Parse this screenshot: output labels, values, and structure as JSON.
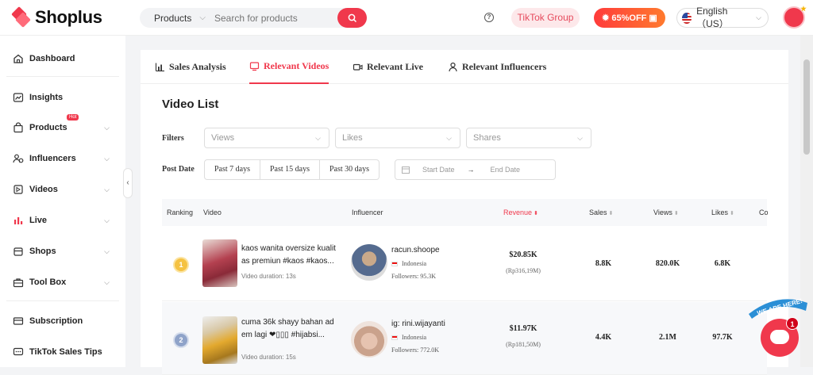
{
  "brand": {
    "name": "Shoplus",
    "accent": "#f0384c"
  },
  "topbar": {
    "search_type": "Products",
    "search_placeholder": "Search for products",
    "tiktok_group": "TikTok Group",
    "promo": "65%OFF",
    "language": "English（US）"
  },
  "sidebar": {
    "items": [
      {
        "label": "Dashboard",
        "icon": "home-icon"
      },
      {
        "label": "Insights",
        "icon": "chart-line-icon"
      },
      {
        "label": "Products",
        "icon": "bag-icon",
        "badge": "Hot"
      },
      {
        "label": "Influencers",
        "icon": "people-icon"
      },
      {
        "label": "Videos",
        "icon": "video-icon"
      },
      {
        "label": "Live",
        "icon": "bar-chart-icon"
      },
      {
        "label": "Shops",
        "icon": "shop-icon"
      },
      {
        "label": "Tool Box",
        "icon": "toolbox-icon"
      },
      {
        "label": "Subscription",
        "icon": "card-icon"
      },
      {
        "label": "TikTok Sales Tips",
        "icon": "chat-icon"
      }
    ]
  },
  "tabs": [
    {
      "label": "Sales Analysis",
      "icon": "bar-chart-icon"
    },
    {
      "label": "Relevant Videos",
      "icon": "monitor-icon",
      "active": true
    },
    {
      "label": "Relevant Live",
      "icon": "camera-icon"
    },
    {
      "label": "Relevant Influencers",
      "icon": "person-icon"
    }
  ],
  "video_list": {
    "title": "Video List",
    "filters_label": "Filters",
    "filters": [
      "Views",
      "Likes",
      "Shares"
    ],
    "post_date_label": "Post Date",
    "date_options": [
      "Past 7 days",
      "Past 15 days",
      "Past 30 days"
    ],
    "start_placeholder": "Start Date",
    "end_placeholder": "End Date",
    "arrow": "→"
  },
  "table": {
    "columns": [
      "Ranking",
      "Video",
      "Influencer",
      "Revenue",
      "Sales",
      "Views",
      "Likes",
      "Co"
    ],
    "rows": [
      {
        "rank": "1",
        "video_title": "kaos wanita oversize kualit as premiun #kaos #kaos...",
        "duration": "Video duration: 13s",
        "influencer": "racun.shoope",
        "country": "Indonesia",
        "followers": "Followers: 95.3K",
        "revenue": "$20.85K",
        "revenue_local": "(Rp316,19M)",
        "sales": "8.8K",
        "views": "820.0K",
        "likes": "6.8K"
      },
      {
        "rank": "2",
        "video_title": "cuma 36k shayy bahan ad em lagi ❤▯▯▯ #hijabsi...",
        "duration": "Video duration: 15s",
        "influencer": "ig: rini.wijayanti",
        "country": "Indonesia",
        "followers": "Followers: 772.0K",
        "revenue": "$11.97K",
        "revenue_local": "(Rp181,50M)",
        "sales": "4.4K",
        "views": "2.1M",
        "likes": "97.7K"
      }
    ]
  },
  "chat": {
    "badge": "1",
    "banner": "WE ARE HERE!"
  }
}
